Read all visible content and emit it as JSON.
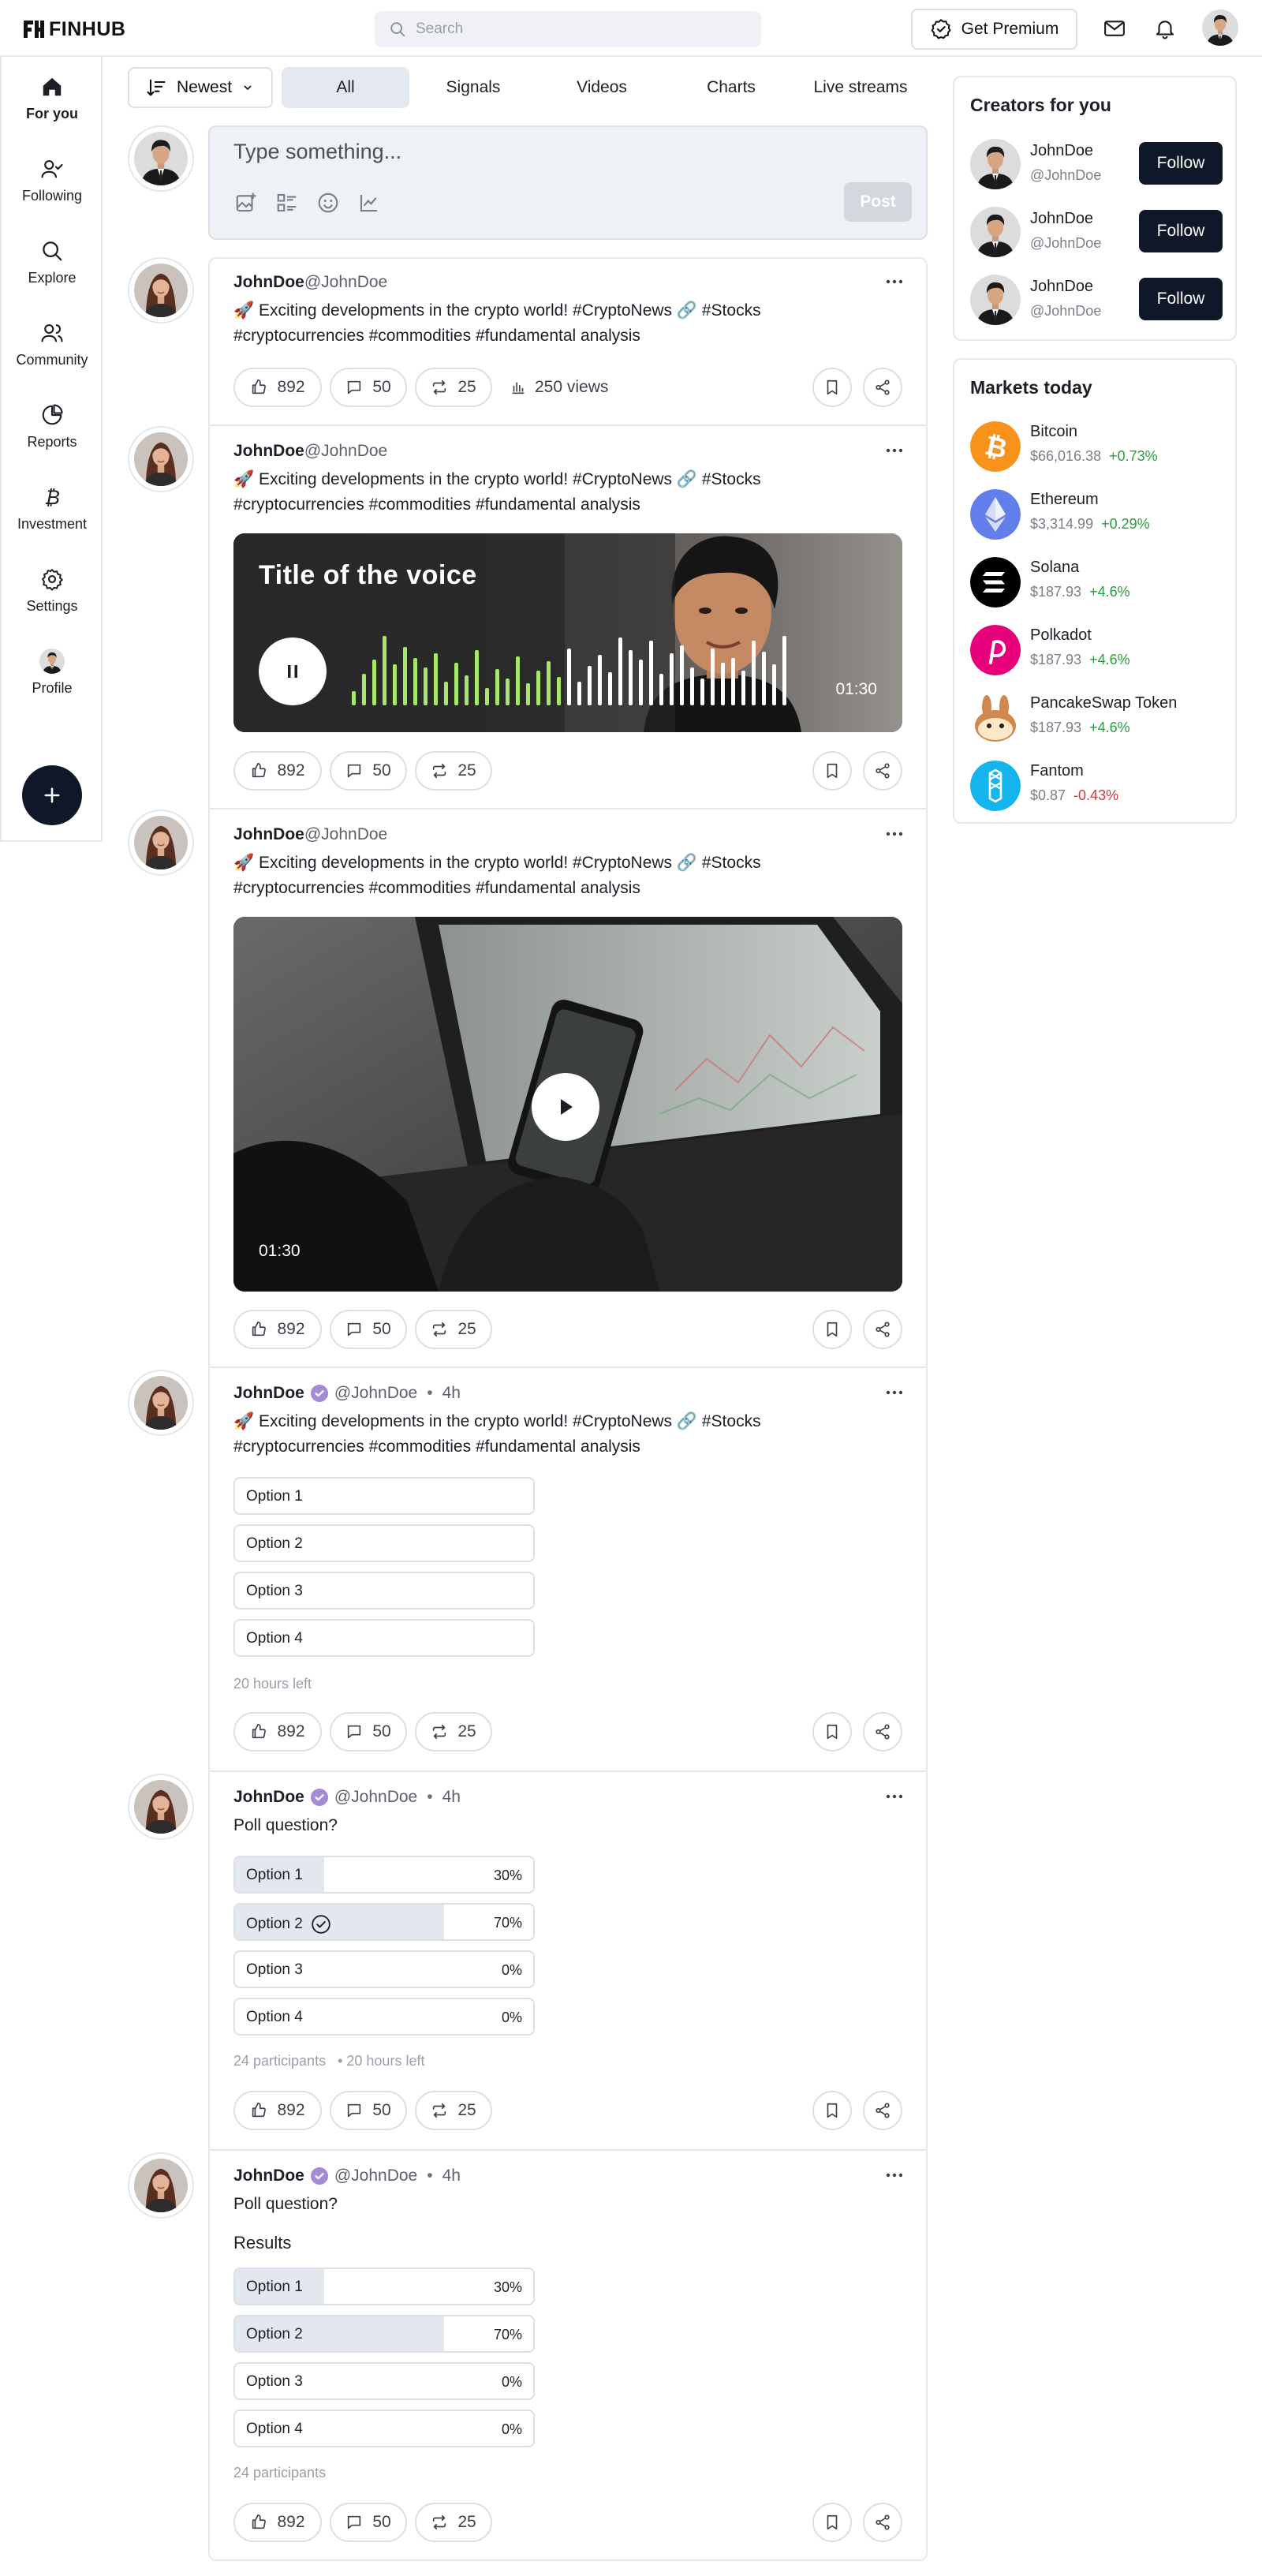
{
  "app": {
    "logo_text": "FINHUB"
  },
  "topbar": {
    "search_placeholder": "Search",
    "premium_label": "Get Premium",
    "icons": [
      "mail-icon",
      "bell-icon"
    ]
  },
  "nav": {
    "items": [
      {
        "label": "For you",
        "icon": "home-icon",
        "active": true
      },
      {
        "label": "Following",
        "icon": "user-check-icon"
      },
      {
        "label": "Explore",
        "icon": "search-icon"
      },
      {
        "label": "Community",
        "icon": "users-icon"
      },
      {
        "label": "Reports",
        "icon": "pie-chart-icon"
      },
      {
        "label": "Investment",
        "icon": "bitcoin-icon"
      },
      {
        "label": "Settings",
        "icon": "gear-icon"
      },
      {
        "label": "Profile",
        "icon": "avatar"
      }
    ],
    "fab_icon": "plus-icon"
  },
  "filter": {
    "sort_label": "Newest",
    "tabs": [
      "All",
      "Signals",
      "Videos",
      "Charts",
      "Live streams"
    ],
    "active_tab": "All"
  },
  "composer": {
    "placeholder": "Type something...",
    "post_label": "Post"
  },
  "posts": [
    {
      "author": "JohnDoe",
      "handle": "@JohnDoe",
      "text_line1": "🚀 Exciting developments in the crypto world! #CryptoNews 🔗  #Stocks",
      "text_line2": "#cryptocurrencies #commodities #fundamental analysis",
      "likes": "892",
      "comments": "50",
      "reposts": "25",
      "views": "250 views"
    },
    {
      "author": "JohnDoe",
      "handle": "@JohnDoe",
      "text_line1": "🚀 Exciting developments in the crypto world! #CryptoNews 🔗  #Stocks",
      "text_line2": "#cryptocurrencies #commodities #fundamental analysis",
      "voice_title": "Title of the voice",
      "voice_time": "01:30",
      "likes": "892",
      "comments": "50",
      "reposts": "25"
    },
    {
      "author": "JohnDoe",
      "handle": "@JohnDoe",
      "text_line1": "🚀 Exciting developments in the crypto world! #CryptoNews 🔗  #Stocks",
      "text_line2": "#cryptocurrencies #commodities #fundamental analysis",
      "video_time": "01:30",
      "likes": "892",
      "comments": "50",
      "reposts": "25"
    },
    {
      "author": "JohnDoe",
      "handle": "@JohnDoe",
      "time": "4h",
      "text_line1": "🚀 Exciting developments in the crypto world! #CryptoNews 🔗  #Stocks",
      "text_line2": "#cryptocurrencies #commodities #fundamental analysis",
      "options": [
        "Option 1",
        "Option 2",
        "Option 3",
        "Option 4"
      ],
      "time_left": "20 hours left",
      "likes": "892",
      "comments": "50",
      "reposts": "25"
    },
    {
      "author": "JohnDoe",
      "handle": "@JohnDoe",
      "time": "4h",
      "question": "Poll question?",
      "options": [
        {
          "label": "Option 1",
          "pct": "30%",
          "fraction": 0.3
        },
        {
          "label": "Option 2",
          "pct": "70%",
          "fraction": 0.7,
          "selected": true
        },
        {
          "label": "Option 3",
          "pct": "0%",
          "fraction": 0
        },
        {
          "label": "Option 4",
          "pct": "0%",
          "fraction": 0
        }
      ],
      "participants": "24 participants",
      "time_left": "20 hours left",
      "likes": "892",
      "comments": "50",
      "reposts": "25"
    },
    {
      "author": "JohnDoe",
      "handle": "@JohnDoe",
      "time": "4h",
      "question": "Poll question?",
      "results_label": "Results",
      "options": [
        {
          "label": "Option 1",
          "pct": "30%",
          "fraction": 0.3
        },
        {
          "label": "Option 2",
          "pct": "70%",
          "fraction": 0.7
        },
        {
          "label": "Option 3",
          "pct": "0%",
          "fraction": 0
        },
        {
          "label": "Option 4",
          "pct": "0%",
          "fraction": 0
        }
      ],
      "participants": "24 participants",
      "likes": "892",
      "comments": "50",
      "reposts": "25"
    }
  ],
  "creators": {
    "title": "Creators for you",
    "items": [
      {
        "name": "JohnDoe",
        "handle": "@JohnDoe",
        "follow_label": "Follow"
      },
      {
        "name": "JohnDoe",
        "handle": "@JohnDoe",
        "follow_label": "Follow"
      },
      {
        "name": "JohnDoe",
        "handle": "@JohnDoe",
        "follow_label": "Follow"
      }
    ]
  },
  "markets": {
    "title": "Markets today",
    "items": [
      {
        "name": "Bitcoin",
        "price": "$66,016.38",
        "change": "+0.73%",
        "color": "#f7931a"
      },
      {
        "name": "Ethereum",
        "price": "$3,314.99",
        "change": "+0.29%",
        "color": "#627eea"
      },
      {
        "name": "Solana",
        "price": "$187.93",
        "change": "+4.6%",
        "color": "#000000"
      },
      {
        "name": "Polkadot",
        "price": "$187.93",
        "change": "+4.6%",
        "color": "#e6007a"
      },
      {
        "name": "PancakeSwap Token",
        "price": "$187.93",
        "change": "+4.6%",
        "color": "#d1884f"
      },
      {
        "name": "Fantom",
        "price": "$0.87",
        "change": "-0.43%",
        "color": "#1969ff"
      }
    ]
  },
  "colors": {
    "primary_dark": "#0f1729",
    "positive": "#2f9a3f",
    "negative": "#d0383f",
    "waveform_active": "#a6e86a"
  }
}
